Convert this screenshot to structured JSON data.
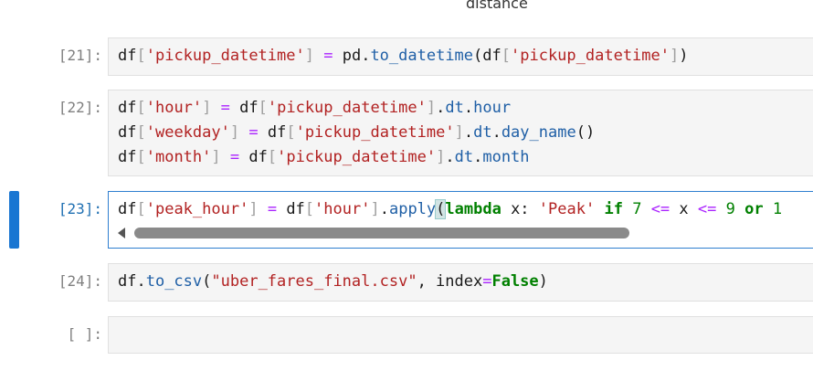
{
  "top_output": "distance",
  "cells": [
    {
      "prompt": "[21]:",
      "lines": [
        [
          [
            "var",
            "df"
          ],
          [
            "br",
            "["
          ],
          [
            "str",
            "'pickup_datetime'"
          ],
          [
            "br",
            "]"
          ],
          [
            "var",
            " "
          ],
          [
            "op",
            "="
          ],
          [
            "var",
            " pd."
          ],
          [
            "attr",
            "to_datetime"
          ],
          [
            "var",
            "(df"
          ],
          [
            "br",
            "["
          ],
          [
            "str",
            "'pickup_datetime'"
          ],
          [
            "br",
            "]"
          ],
          [
            "var",
            ")"
          ]
        ]
      ]
    },
    {
      "prompt": "[22]:",
      "lines": [
        [
          [
            "var",
            "df"
          ],
          [
            "br",
            "["
          ],
          [
            "str",
            "'hour'"
          ],
          [
            "br",
            "]"
          ],
          [
            "var",
            " "
          ],
          [
            "op",
            "="
          ],
          [
            "var",
            " df"
          ],
          [
            "br",
            "["
          ],
          [
            "str",
            "'pickup_datetime'"
          ],
          [
            "br",
            "]"
          ],
          [
            "var",
            "."
          ],
          [
            "attr",
            "dt"
          ],
          [
            "var",
            "."
          ],
          [
            "attr",
            "hour"
          ]
        ],
        [
          [
            "var",
            "df"
          ],
          [
            "br",
            "["
          ],
          [
            "str",
            "'weekday'"
          ],
          [
            "br",
            "]"
          ],
          [
            "var",
            " "
          ],
          [
            "op",
            "="
          ],
          [
            "var",
            " df"
          ],
          [
            "br",
            "["
          ],
          [
            "str",
            "'pickup_datetime'"
          ],
          [
            "br",
            "]"
          ],
          [
            "var",
            "."
          ],
          [
            "attr",
            "dt"
          ],
          [
            "var",
            "."
          ],
          [
            "attr",
            "day_name"
          ],
          [
            "var",
            "()"
          ]
        ],
        [
          [
            "var",
            "df"
          ],
          [
            "br",
            "["
          ],
          [
            "str",
            "'month'"
          ],
          [
            "br",
            "]"
          ],
          [
            "var",
            " "
          ],
          [
            "op",
            "="
          ],
          [
            "var",
            " df"
          ],
          [
            "br",
            "["
          ],
          [
            "str",
            "'pickup_datetime'"
          ],
          [
            "br",
            "]"
          ],
          [
            "var",
            "."
          ],
          [
            "attr",
            "dt"
          ],
          [
            "var",
            "."
          ],
          [
            "attr",
            "month"
          ]
        ]
      ]
    },
    {
      "prompt": "[23]:",
      "lines": [
        [
          [
            "var",
            "df"
          ],
          [
            "br",
            "["
          ],
          [
            "str",
            "'peak_hour'"
          ],
          [
            "br",
            "]"
          ],
          [
            "var",
            " "
          ],
          [
            "op",
            "="
          ],
          [
            "var",
            " df"
          ],
          [
            "br",
            "["
          ],
          [
            "str",
            "'hour'"
          ],
          [
            "br",
            "]"
          ],
          [
            "var",
            "."
          ],
          [
            "attr",
            "apply"
          ],
          [
            "match",
            "("
          ],
          [
            "kw",
            "lambda"
          ],
          [
            "var",
            " x: "
          ],
          [
            "str",
            "'Peak'"
          ],
          [
            "var",
            " "
          ],
          [
            "kw",
            "if"
          ],
          [
            "var",
            " "
          ],
          [
            "num",
            "7"
          ],
          [
            "var",
            " "
          ],
          [
            "op",
            "<="
          ],
          [
            "var",
            " x "
          ],
          [
            "op",
            "<="
          ],
          [
            "var",
            " "
          ],
          [
            "num",
            "9"
          ],
          [
            "var",
            " "
          ],
          [
            "kw",
            "or"
          ],
          [
            "var",
            " "
          ],
          [
            "num",
            "1"
          ]
        ]
      ]
    },
    {
      "prompt": "[24]:",
      "lines": [
        [
          [
            "var",
            "df."
          ],
          [
            "attr",
            "to_csv"
          ],
          [
            "var",
            "("
          ],
          [
            "str",
            "\"uber_fares_final.csv\""
          ],
          [
            "var",
            ", index"
          ],
          [
            "op",
            "="
          ],
          [
            "kw",
            "False"
          ],
          [
            "var",
            ")"
          ]
        ]
      ]
    },
    {
      "prompt": "[ ]:",
      "lines": []
    }
  ]
}
